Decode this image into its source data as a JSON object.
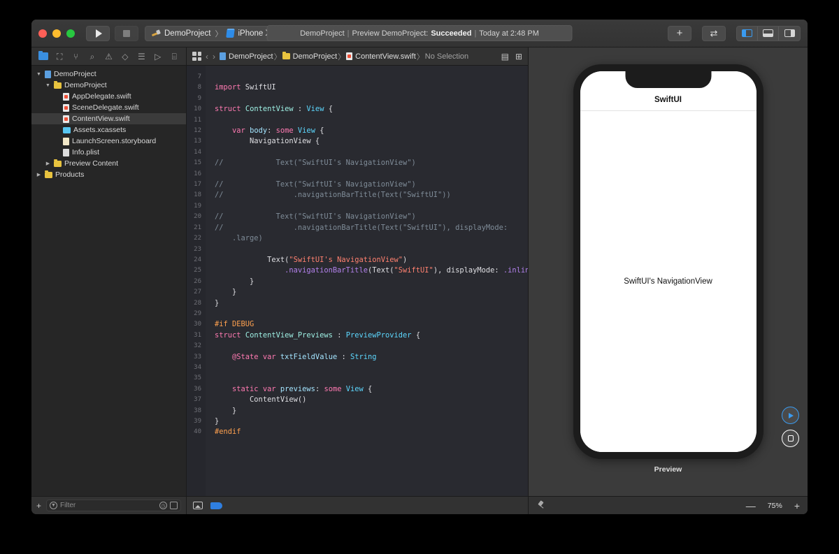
{
  "titlebar": {
    "run_label": "Run",
    "stop_label": "Stop",
    "scheme_project": "DemoProject",
    "scheme_separator": "〉",
    "scheme_device": "iPhone Xʀ",
    "status_project": "DemoProject",
    "status_sep1": "|",
    "status_action": "Preview DemoProject:",
    "status_result": "Succeeded",
    "status_sep2": "|",
    "status_time": "Today at 2:48 PM",
    "add_label": "+",
    "swap_label": "⇄",
    "panel_left": "Navigator",
    "panel_bottom": "Debug Area",
    "panel_right": "Inspector"
  },
  "navigator": {
    "tabs": [
      {
        "name": "project-navigator",
        "icon": "folder-icon",
        "active": true
      },
      {
        "name": "source-control-navigator",
        "icon": "source-control-icon",
        "glyph": "⛶"
      },
      {
        "name": "symbol-navigator",
        "icon": "symbol-hierarchy-icon",
        "glyph": "⑂"
      },
      {
        "name": "find-navigator",
        "icon": "search-icon",
        "glyph": "⌕"
      },
      {
        "name": "issue-navigator",
        "icon": "warning-triangle-icon",
        "glyph": "⚠"
      },
      {
        "name": "test-navigator",
        "icon": "diamond-icon",
        "glyph": "◇"
      },
      {
        "name": "debug-navigator",
        "icon": "report-icon",
        "glyph": "☰"
      },
      {
        "name": "breakpoint-navigator",
        "icon": "tag-icon",
        "glyph": "▷"
      },
      {
        "name": "report-navigator",
        "icon": "speech-bubble-icon",
        "glyph": "⌸"
      }
    ],
    "tree": [
      {
        "label": "DemoProject",
        "indent": 0,
        "twisty": "▼",
        "icon": "project-icon"
      },
      {
        "label": "DemoProject",
        "indent": 1,
        "twisty": "▼",
        "icon": "folder-icon"
      },
      {
        "label": "AppDelegate.swift",
        "indent": 2,
        "twisty": "",
        "icon": "swift-file-icon"
      },
      {
        "label": "SceneDelegate.swift",
        "indent": 2,
        "twisty": "",
        "icon": "swift-file-icon"
      },
      {
        "label": "ContentView.swift",
        "indent": 2,
        "twisty": "",
        "icon": "swift-file-icon",
        "selected": true
      },
      {
        "label": "Assets.xcassets",
        "indent": 2,
        "twisty": "",
        "icon": "assets-icon"
      },
      {
        "label": "LaunchScreen.storyboard",
        "indent": 2,
        "twisty": "",
        "icon": "storyboard-icon"
      },
      {
        "label": "Info.plist",
        "indent": 2,
        "twisty": "",
        "icon": "plist-icon"
      },
      {
        "label": "Preview Content",
        "indent": 1,
        "twisty": "▶",
        "icon": "folder-icon"
      },
      {
        "label": "Products",
        "indent": 0,
        "twisty": "▶",
        "icon": "folder-icon"
      }
    ],
    "add_button": "+",
    "filter_placeholder": "Filter"
  },
  "jumpbar": {
    "crumbs": [
      {
        "label": "DemoProject",
        "icon": "project-icon"
      },
      {
        "label": "DemoProject",
        "icon": "folder-icon"
      },
      {
        "label": "ContentView.swift",
        "icon": "swift-file-icon"
      },
      {
        "label": "No Selection",
        "icon": "",
        "dim": true
      }
    ],
    "separator": "〉",
    "back": "‹",
    "forward": "›"
  },
  "editor": {
    "first_line_number": 7,
    "last_line_number": 40,
    "lines": [
      {
        "n": 7,
        "tokens": []
      },
      {
        "n": 8,
        "tokens": [
          {
            "t": "import",
            "c": "kw"
          },
          {
            "t": " SwiftUI",
            "c": ""
          }
        ]
      },
      {
        "n": 9,
        "tokens": []
      },
      {
        "n": 10,
        "tokens": [
          {
            "t": "struct",
            "c": "kw"
          },
          {
            "t": " ",
            "c": ""
          },
          {
            "t": "ContentView",
            "c": "typ2"
          },
          {
            "t": " : ",
            "c": ""
          },
          {
            "t": "View",
            "c": "ty"
          },
          {
            "t": " {",
            "c": ""
          }
        ]
      },
      {
        "n": 11,
        "tokens": []
      },
      {
        "n": 12,
        "tokens": [
          {
            "t": "    ",
            "c": ""
          },
          {
            "t": "var",
            "c": "kw"
          },
          {
            "t": " ",
            "c": ""
          },
          {
            "t": "body",
            "c": "var2"
          },
          {
            "t": ": ",
            "c": ""
          },
          {
            "t": "some",
            "c": "kw"
          },
          {
            "t": " ",
            "c": ""
          },
          {
            "t": "View",
            "c": "ty"
          },
          {
            "t": " {",
            "c": ""
          }
        ]
      },
      {
        "n": 13,
        "tokens": [
          {
            "t": "        NavigationView {",
            "c": ""
          }
        ]
      },
      {
        "n": 14,
        "tokens": []
      },
      {
        "n": 15,
        "tokens": [
          {
            "t": "//            Text(\"SwiftUI's NavigationView\")",
            "c": "cmt"
          }
        ]
      },
      {
        "n": 16,
        "tokens": []
      },
      {
        "n": 17,
        "tokens": [
          {
            "t": "//            Text(\"SwiftUI's NavigationView\")",
            "c": "cmt"
          }
        ]
      },
      {
        "n": 18,
        "tokens": [
          {
            "t": "//                .navigationBarTitle(Text(\"SwiftUI\"))",
            "c": "cmt"
          }
        ]
      },
      {
        "n": 19,
        "tokens": []
      },
      {
        "n": 20,
        "tokens": [
          {
            "t": "//            Text(\"SwiftUI's NavigationView\")",
            "c": "cmt"
          }
        ]
      },
      {
        "n": 21,
        "tokens": [
          {
            "t": "//                .navigationBarTitle(Text(\"SwiftUI\"), displayMode:",
            "c": "cmt"
          }
        ]
      },
      {
        "n": null,
        "tokens": [
          {
            "t": "    .large)",
            "c": "cmt"
          }
        ]
      },
      {
        "n": 22,
        "tokens": []
      },
      {
        "n": 23,
        "tokens": [
          {
            "t": "            Text(",
            "c": ""
          },
          {
            "t": "\"SwiftUI's NavigationView\"",
            "c": "str"
          },
          {
            "t": ")",
            "c": ""
          }
        ]
      },
      {
        "n": 24,
        "tokens": [
          {
            "t": "                ",
            "c": ""
          },
          {
            "t": ".navigationBarTitle",
            "c": "mth"
          },
          {
            "t": "(Text(",
            "c": ""
          },
          {
            "t": "\"SwiftUI\"",
            "c": "str"
          },
          {
            "t": "), displayMode: ",
            "c": ""
          },
          {
            "t": ".inline",
            "c": "mth"
          },
          {
            "t": ")",
            "c": ""
          }
        ]
      },
      {
        "n": 25,
        "tokens": [
          {
            "t": "        }",
            "c": ""
          }
        ]
      },
      {
        "n": 26,
        "tokens": [
          {
            "t": "    }",
            "c": ""
          }
        ]
      },
      {
        "n": 27,
        "tokens": [
          {
            "t": "}",
            "c": ""
          }
        ]
      },
      {
        "n": 28,
        "tokens": []
      },
      {
        "n": 29,
        "tokens": [
          {
            "t": "#if DEBUG",
            "c": "pre"
          }
        ]
      },
      {
        "n": 30,
        "tokens": [
          {
            "t": "struct",
            "c": "kw"
          },
          {
            "t": " ",
            "c": ""
          },
          {
            "t": "ContentView_Previews",
            "c": "typ2"
          },
          {
            "t": " : ",
            "c": ""
          },
          {
            "t": "PreviewProvider",
            "c": "ty"
          },
          {
            "t": " {",
            "c": ""
          }
        ]
      },
      {
        "n": 31,
        "tokens": []
      },
      {
        "n": 32,
        "tokens": [
          {
            "t": "    ",
            "c": ""
          },
          {
            "t": "@State",
            "c": "kw"
          },
          {
            "t": " ",
            "c": ""
          },
          {
            "t": "var",
            "c": "kw"
          },
          {
            "t": " ",
            "c": ""
          },
          {
            "t": "txtFieldValue",
            "c": "var2"
          },
          {
            "t": " : ",
            "c": ""
          },
          {
            "t": "String",
            "c": "ty"
          }
        ]
      },
      {
        "n": 33,
        "tokens": []
      },
      {
        "n": 34,
        "tokens": []
      },
      {
        "n": 35,
        "tokens": [
          {
            "t": "    ",
            "c": ""
          },
          {
            "t": "static",
            "c": "kw"
          },
          {
            "t": " ",
            "c": ""
          },
          {
            "t": "var",
            "c": "kw"
          },
          {
            "t": " ",
            "c": ""
          },
          {
            "t": "previews",
            "c": "var2"
          },
          {
            "t": ": ",
            "c": ""
          },
          {
            "t": "some",
            "c": "kw"
          },
          {
            "t": " ",
            "c": ""
          },
          {
            "t": "View",
            "c": "ty"
          },
          {
            "t": " {",
            "c": ""
          }
        ]
      },
      {
        "n": 36,
        "tokens": [
          {
            "t": "        ContentView()",
            "c": ""
          }
        ]
      },
      {
        "n": 37,
        "tokens": [
          {
            "t": "    }",
            "c": ""
          }
        ]
      },
      {
        "n": 38,
        "tokens": [
          {
            "t": "}",
            "c": ""
          }
        ]
      },
      {
        "n": 39,
        "tokens": [
          {
            "t": "#endif",
            "c": "pre"
          }
        ]
      },
      {
        "n": 40,
        "tokens": []
      }
    ]
  },
  "canvas": {
    "device": "iPhone Xʀ",
    "nav_title": "SwiftUI",
    "body_text": "SwiftUI's NavigationView",
    "preview_label": "Preview",
    "live_preview": "Live Preview",
    "inspect_preview": "Inspect Preview",
    "zoom_out": "—",
    "zoom_value": "75%",
    "zoom_in": "+",
    "pin_label": "Pin Preview"
  },
  "colors": {
    "accent_blue": "#3a9bf0",
    "editor_bg": "#292a30",
    "gutter_bg": "#26272d",
    "chrome_bg": "#323232",
    "canvas_bg": "#3b3b3b",
    "string": "#ff8170",
    "keyword": "#ff7ab2",
    "type": "#5dd8ff",
    "comment": "#7f8c98",
    "method": "#b281eb",
    "preprocessor": "#ffa14f"
  }
}
